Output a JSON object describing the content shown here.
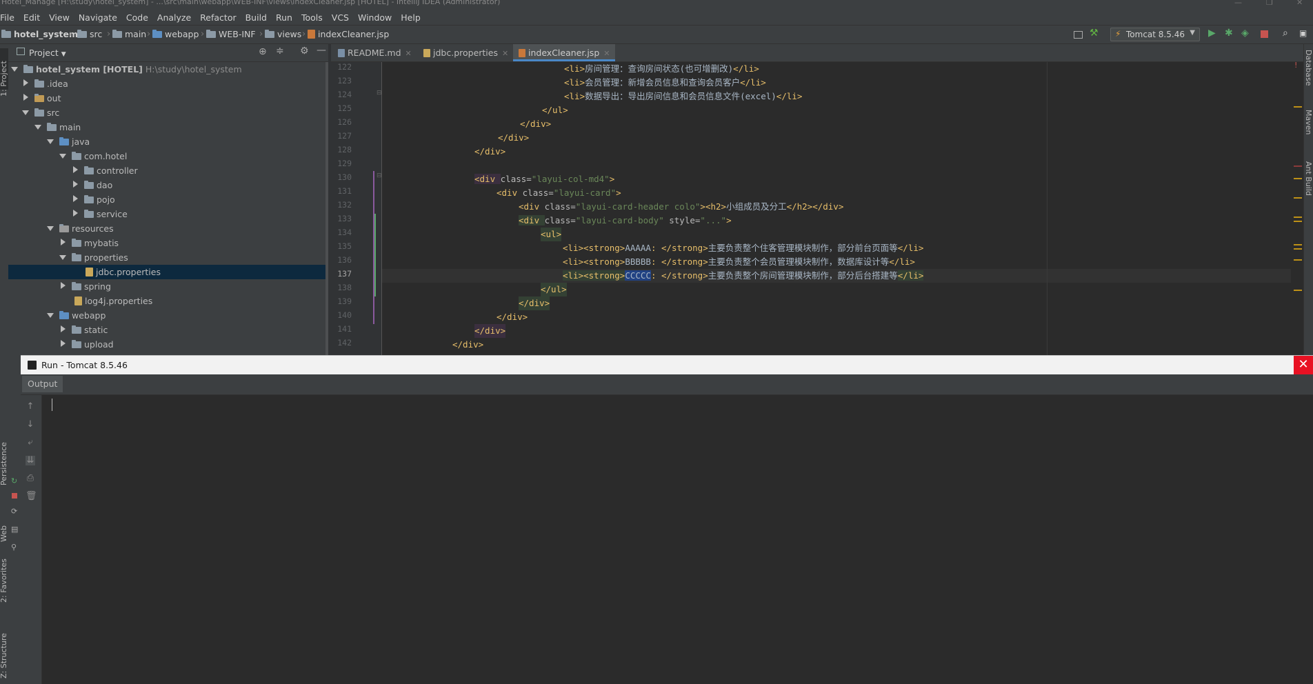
{
  "window": {
    "title": "Hotel_Manage [H:\\study\\hotel_system] - ...\\src\\main\\webapp\\WEB-INF\\views\\indexCleaner.jsp [HOTEL] - IntelliJ IDEA (Administrator)"
  },
  "menu": [
    "File",
    "Edit",
    "View",
    "Navigate",
    "Code",
    "Analyze",
    "Refactor",
    "Build",
    "Run",
    "Tools",
    "VCS",
    "Window",
    "Help"
  ],
  "breadcrumbs": [
    "hotel_system",
    "src",
    "main",
    "webapp",
    "WEB-INF",
    "views",
    "indexCleaner.jsp"
  ],
  "toolbar": {
    "run_config": "Tomcat 8.5.46"
  },
  "left_stripe": {
    "project": "1: Project",
    "persistence": "Persistence",
    "web": "Web",
    "favorites": "2: Favorites",
    "structure": "Z: Structure"
  },
  "right_stripe": {
    "database": "Database",
    "maven": "Maven",
    "ant": "Ant Build"
  },
  "project_panel": {
    "header": "Project",
    "tree": [
      {
        "label": "hotel_system [HOTEL]",
        "extra": "H:\\study\\hotel_system"
      },
      {
        "label": ".idea"
      },
      {
        "label": "out"
      },
      {
        "label": "src"
      },
      {
        "label": "main"
      },
      {
        "label": "java"
      },
      {
        "label": "com.hotel"
      },
      {
        "label": "controller"
      },
      {
        "label": "dao"
      },
      {
        "label": "pojo"
      },
      {
        "label": "service"
      },
      {
        "label": "resources"
      },
      {
        "label": "mybatis"
      },
      {
        "label": "properties"
      },
      {
        "label": "jdbc.properties"
      },
      {
        "label": "spring"
      },
      {
        "label": "log4j.properties"
      },
      {
        "label": "webapp"
      },
      {
        "label": "static"
      },
      {
        "label": "upload"
      }
    ]
  },
  "editor": {
    "tabs": [
      "README.md",
      "jdbc.properties",
      "indexCleaner.jsp"
    ],
    "line_numbers": [
      "122",
      "123",
      "124",
      "125",
      "126",
      "127",
      "128",
      "129",
      "130",
      "131",
      "132",
      "133",
      "134",
      "135",
      "136",
      "137",
      "138",
      "139",
      "140",
      "141",
      "142"
    ],
    "current_line": "137",
    "lines": {
      "l122": {
        "open": "<li>",
        "text": "房间管理：查询房间状态(也可增删改)",
        "close": "</li>"
      },
      "l123": {
        "open": "<li>",
        "text": "会员管理：新增会员信息和查询会员客户",
        "close": "</li>"
      },
      "l124": {
        "open": "<li>",
        "text": "数据导出：导出房间信息和会员信息文件(excel)",
        "close": "</li>"
      },
      "l125": "</ul>",
      "l126": "</div>",
      "l127": "</div>",
      "l128": "</div>",
      "l130": {
        "tag": "<div ",
        "attr": "class=",
        "val": "\"layui-col-md4\"",
        "end": ">"
      },
      "l131": {
        "tag": "<div ",
        "attr": "class=",
        "val": "\"layui-card\"",
        "end": ">"
      },
      "l132": {
        "tag": "<div ",
        "attr": "class=",
        "val": "\"layui-card-header colo\"",
        "mid": "><h2>",
        "text": "小组成员及分工",
        "close": "</h2></div>"
      },
      "l133": {
        "tag": "<div ",
        "attr": "class=",
        "val": "\"layui-card-body\"",
        "attr2": " style=",
        "val2": "\"...\"",
        "end": ">"
      },
      "l134": "<ul>",
      "l135": {
        "open": "<li><strong>",
        "name": "AAAAA",
        "mid": ": </strong>",
        "text": "主要负责整个住客管理模块制作，部分前台页面等",
        "close": "</li>"
      },
      "l136": {
        "open": "<li><strong>",
        "name": "BBBBB",
        "mid": ": </strong>",
        "text": "主要负责整个会员管理模块制作，数据库设计等",
        "close": "</li>"
      },
      "l137": {
        "open": "<li><strong>",
        "name": "CCCCC",
        "mid": ": </strong>",
        "text": "主要负责整个房间管理模块制作，部分后台搭建等",
        "close": "</li>"
      },
      "l138": "</ul>",
      "l139": "</div>",
      "l140": "</div>",
      "l141": "</div>",
      "l142": "</div>"
    }
  },
  "run_window": {
    "title": "Run - Tomcat 8.5.46",
    "tab": "Output",
    "close": "✕"
  }
}
